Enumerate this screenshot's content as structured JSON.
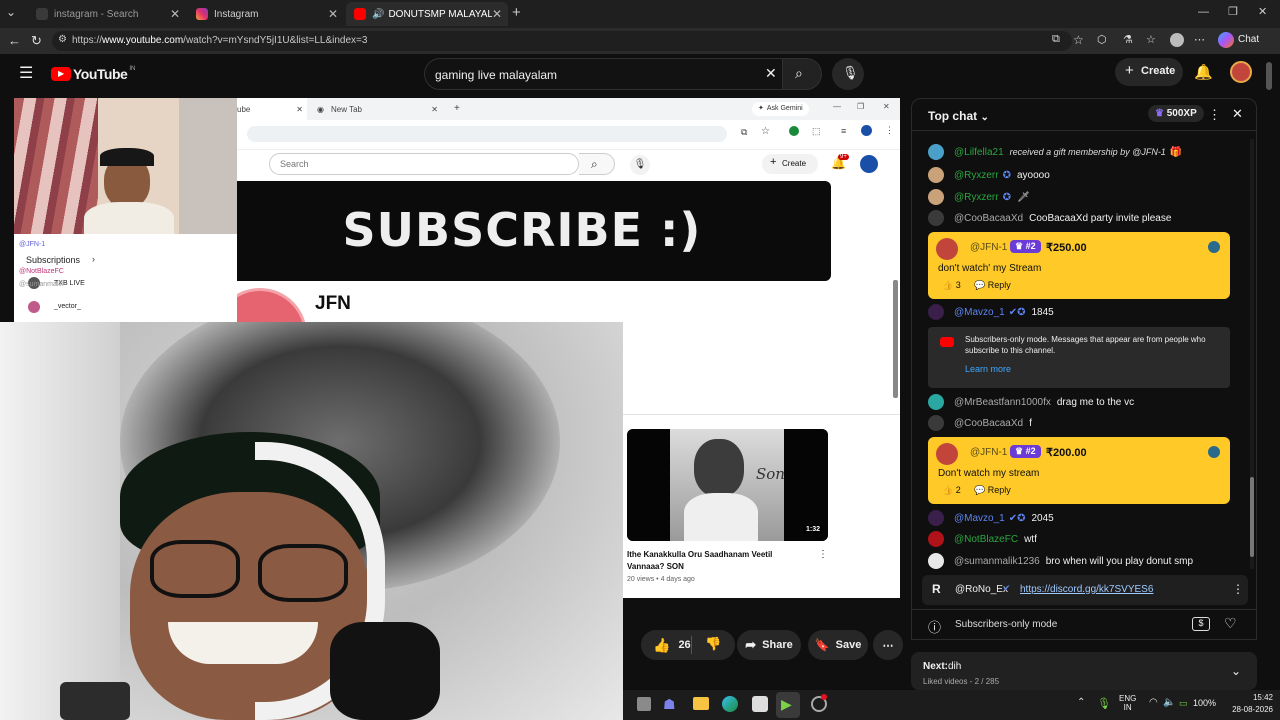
{
  "browser": {
    "tabs": [
      {
        "label": "instagram - Search",
        "active": false
      },
      {
        "label": "Instagram",
        "active": false
      },
      {
        "label": "DONUTSMP MALAYALAM DA",
        "active": true
      }
    ],
    "url_prefix": "https://",
    "url_host": "www.youtube.com",
    "url_path": "/watch?v=mYsndY5jI1U&list=LL&index=3",
    "chat_label": "Chat"
  },
  "youtube": {
    "logo": "YouTube",
    "region": "IN",
    "search_value": "gaming live malayalam",
    "create_label": "Create"
  },
  "stream": {
    "inner_tab_label": "ube",
    "inner_newtab": "New Tab",
    "ask_gemini": "Ask Gemini",
    "inner_search_placeholder": "Search",
    "inner_create": "Create",
    "inner_notif_count": "9+",
    "subscribe_banner": "SUBSCRIBE :)",
    "channel_name": "JFN",
    "overlay_lines": [
      "@JFN-1",
      "@NotBlazeFC",
      "@sumanmalik"
    ],
    "overlay_subscriptions": "Subscriptions",
    "overlay_channels": [
      "TXB LIVE",
      "_vector_"
    ],
    "video_title": "Ithe Kanakkulla Oru Saadhanam Veetil Vannaaa? SON",
    "video_meta": "20 views • 4 days ago",
    "video_duration": "1:32",
    "thumb_text": "Son"
  },
  "actions": {
    "like_count": "26",
    "share": "Share",
    "save": "Save"
  },
  "chat": {
    "header": "Top chat",
    "xp": "500XP",
    "gift_user": "@Lilfella21",
    "gift_text": "received a gift membership by @JFN-1",
    "messages_top": [
      {
        "user": "@Ryxzerr",
        "text": "ayoooo",
        "cls": "mem",
        "color": "#c9a27a"
      },
      {
        "user": "@Ryxzerr",
        "text": "🗡",
        "cls": "mem",
        "color": "#c9a27a"
      },
      {
        "user": "@CooBacaaXd",
        "text": "CooBacaaXd party invite please",
        "cls": "",
        "color": "#3a3a3a"
      }
    ],
    "superchat1": {
      "user": "@JFN-1",
      "rank": "#2",
      "amount": "₹250.00",
      "text": "don't watch' my Stream",
      "likes": "3",
      "reply": "Reply"
    },
    "mavzo1": {
      "user": "@Mavzo_1",
      "text": "1845"
    },
    "notice_text": "Subscribers-only mode. Messages that appear are from people who subscribe to this channel.",
    "notice_link": "Learn more",
    "messages_mid": [
      {
        "user": "@MrBeastfann1000fx",
        "text": "drag me to the vc",
        "color": "#2aa7a0"
      },
      {
        "user": "@CooBacaaXd",
        "text": "f",
        "color": "#3a3a3a"
      }
    ],
    "superchat2": {
      "user": "@JFN-1",
      "rank": "#2",
      "amount": "₹200.00",
      "text": "Don't watch my stream",
      "likes": "2",
      "reply": "Reply"
    },
    "mavzo2": {
      "user": "@Mavzo_1",
      "text": "2045"
    },
    "notblaze": {
      "user": "@NotBlazeFC",
      "text": "wtf"
    },
    "suman": {
      "user": "@sumanmalik1236",
      "text": "bro when will you play donut smp"
    },
    "pinned": {
      "user": "@RoNo_Ex",
      "link": "https://discord.gg/kk7SVYES6"
    },
    "input_mode": "Subscribers-only mode",
    "next_label": "Next:",
    "next_title": "dih",
    "next_meta": "Liked videos - 2 / 285"
  },
  "taskbar": {
    "lang1": "ENG",
    "lang2": "IN",
    "battery": "100%",
    "time": "15:42",
    "date": "28-08-2026"
  },
  "colors": {
    "accent_red": "#ff0000",
    "superchat": "#ffca28",
    "link_blue": "#3ea6ff"
  }
}
